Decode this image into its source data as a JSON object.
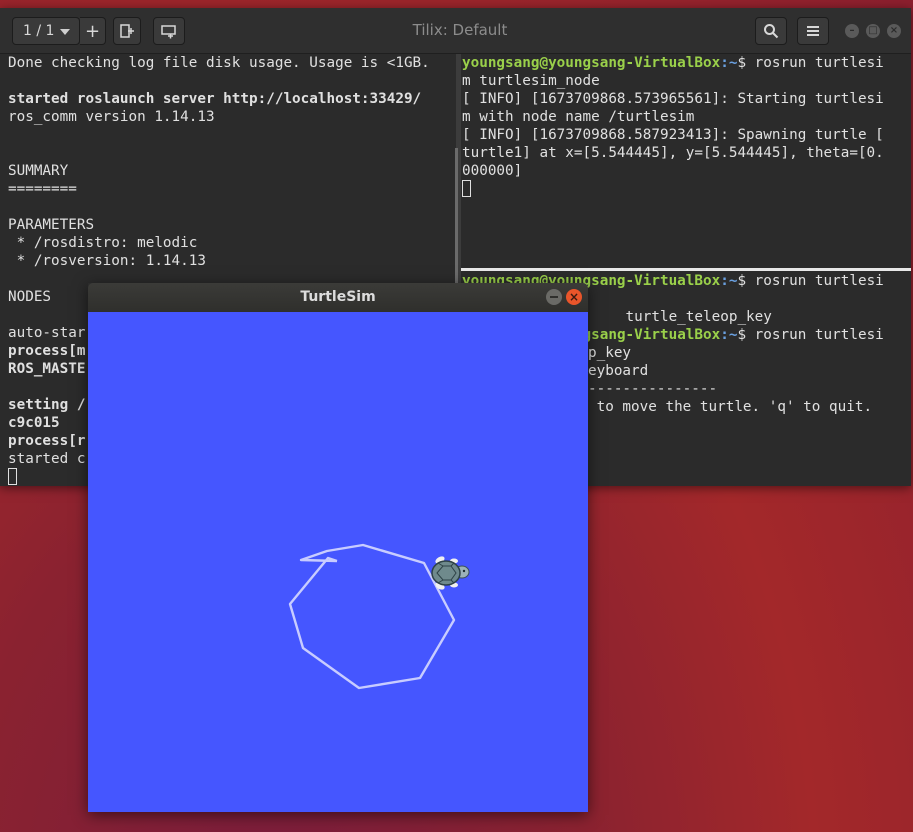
{
  "tilix": {
    "title": "Tilix: Default",
    "session": "1 / 1",
    "add_label": "+"
  },
  "left_pane": {
    "lines": [
      "Done checking log file disk usage. Usage is <1GB.",
      "",
      "started roslaunch server http://localhost:33429/",
      "ros_comm version 1.14.13",
      "",
      "",
      "SUMMARY",
      "========",
      "",
      "PARAMETERS",
      " * /rosdistro: melodic",
      " * /rosversion: 1.14.13",
      "",
      "NODES",
      "",
      "auto-star",
      "process[m",
      "ROS_MASTE",
      "",
      "setting /",
      "c9c015",
      "process[r",
      "started c"
    ]
  },
  "right_top": {
    "prompt_user": "youngsang@youngsang-VirtualBox",
    "prompt_path": ":~",
    "prompt_cmd": "$ rosrun turtlesi",
    "lines": [
      "m turtlesim_node",
      "[ INFO] [1673709868.573965561]: Starting turtlesi",
      "m with node name /turtlesim",
      "[ INFO] [1673709868.587923413]: Spawning turtle [",
      "turtle1] at x=[5.544445], y=[5.544445], theta=[0.",
      "000000]"
    ]
  },
  "right_bottom": {
    "prompt1_user": "youngsang@youngsang-VirtualBox",
    "prompt1_path": ":~",
    "prompt1_cmd": "$ rosrun turtlesi",
    "line2": "                   turtle_teleop_key",
    "prompt2_user": "youngsang-VirtualBox",
    "prompt2_path": ":~",
    "prompt2_cmd": "$ rosrun turtlesi",
    "line4": "p_key",
    "line5": "eyboard",
    "line6": "---------------",
    "line7": " to move the turtle. 'q' to quit."
  },
  "turtlesim": {
    "title": "TurtleSim",
    "close_glyph": "×",
    "background_color": "#4556ff",
    "path_color": "#c8ccff"
  }
}
